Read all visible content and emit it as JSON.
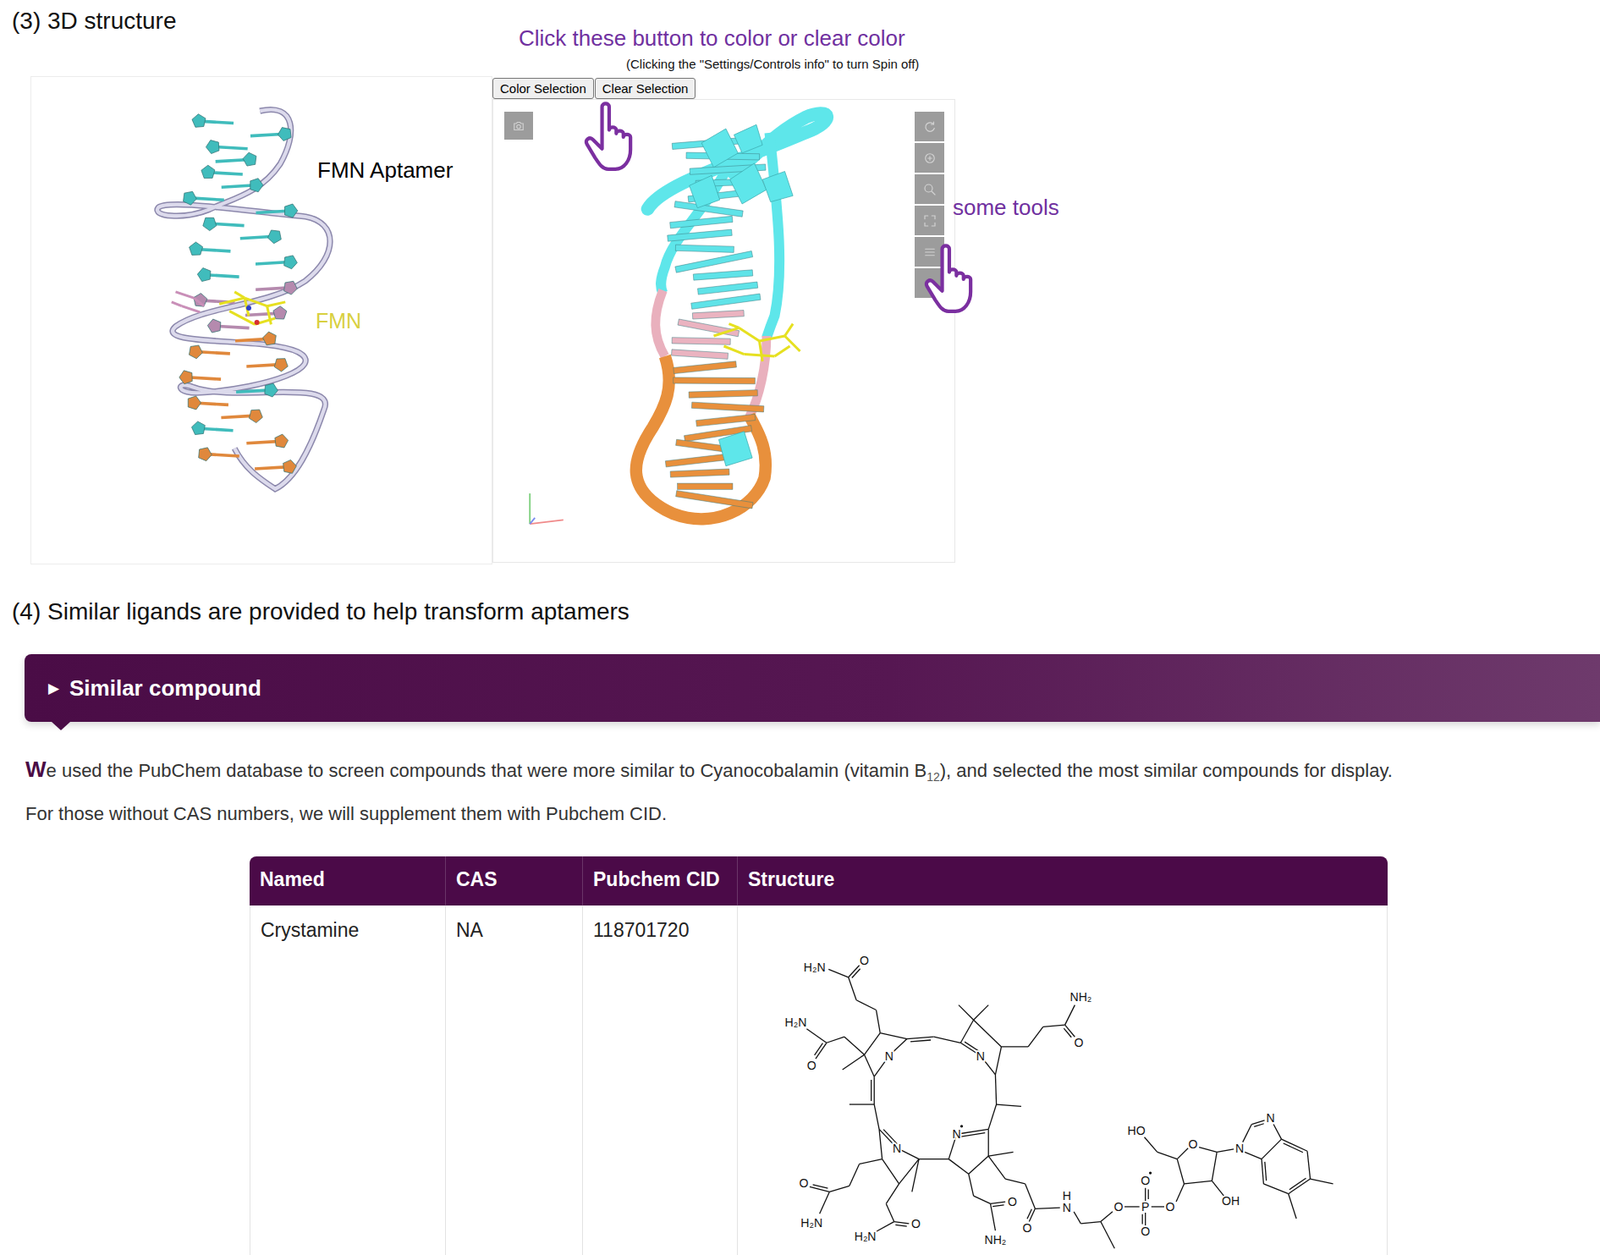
{
  "structure_section": {
    "heading": "(3) 3D structure",
    "annotation": {
      "title": "Click these button to color or clear color",
      "note": "(Clicking the \"Settings/Controls info\" to turn Spin off)",
      "tools_label": "some tools"
    },
    "buttons": [
      "Color Selection",
      "Clear Selection"
    ],
    "model_labels": [
      {
        "text": "FMN Aptamer",
        "color": "#000000"
      },
      {
        "text": "FMN",
        "color": "#d8d040"
      }
    ]
  },
  "ligand_section": {
    "heading": "(4) Similar ligands are provided to help transform aptamers",
    "accordion": {
      "icon": "▶",
      "title": "Similar compound",
      "expanded": false
    },
    "intro": {
      "lead": "W",
      "before_subscript": "e used the PubChem database to screen compounds that were more similar to Cyanocobalamin (vitamin B",
      "subscript": "12",
      "after_subscript": "), and selected the most similar compounds for display.",
      "second_line": "For those without CAS numbers, we will supplement them with Pubchem CID."
    },
    "table": {
      "columns": [
        "Named",
        "CAS",
        "Pubchem CID",
        "Structure"
      ],
      "rows": [
        {
          "name": "Crystamine",
          "cas": "NA",
          "cid": "118701720",
          "atom_labels": [
            "H₂N",
            "O",
            "NH₂",
            "H₂N",
            "O",
            "O",
            "N",
            "N",
            "HO",
            "N",
            "N",
            "O",
            "N",
            "N",
            "O",
            "O",
            "OH",
            "O",
            "H",
            "N",
            "O",
            "P",
            "O",
            "H₂N",
            "O",
            "O",
            "O",
            "H₂N",
            "NH₂"
          ]
        }
      ]
    }
  }
}
